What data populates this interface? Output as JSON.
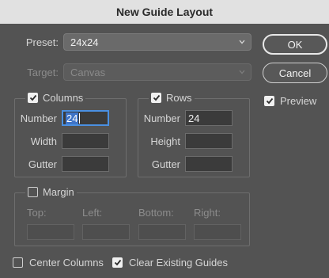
{
  "window": {
    "title": "New Guide Layout"
  },
  "preset": {
    "label": "Preset:",
    "value": "24x24"
  },
  "target": {
    "label": "Target:",
    "value": "Canvas"
  },
  "buttons": {
    "ok": "OK",
    "cancel": "Cancel"
  },
  "preview": {
    "label": "Preview",
    "checked": true
  },
  "columns": {
    "label": "Columns",
    "checked": true,
    "number_label": "Number",
    "number_value": "24",
    "width_label": "Width",
    "width_value": "",
    "gutter_label": "Gutter",
    "gutter_value": ""
  },
  "rows": {
    "label": "Rows",
    "checked": true,
    "number_label": "Number",
    "number_value": "24",
    "height_label": "Height",
    "height_value": "",
    "gutter_label": "Gutter",
    "gutter_value": ""
  },
  "margin": {
    "label": "Margin",
    "checked": false,
    "top_label": "Top:",
    "left_label": "Left:",
    "bottom_label": "Bottom:",
    "right_label": "Right:"
  },
  "center_columns": {
    "label": "Center Columns",
    "checked": false
  },
  "clear_guides": {
    "label": "Clear Existing Guides",
    "checked": true
  },
  "icons": {
    "check": "checkmark-icon",
    "chevron": "chevron-down-icon"
  },
  "colors": {
    "focus": "#4a90e2",
    "selection": "#3f74c7",
    "panel": "#535353"
  }
}
